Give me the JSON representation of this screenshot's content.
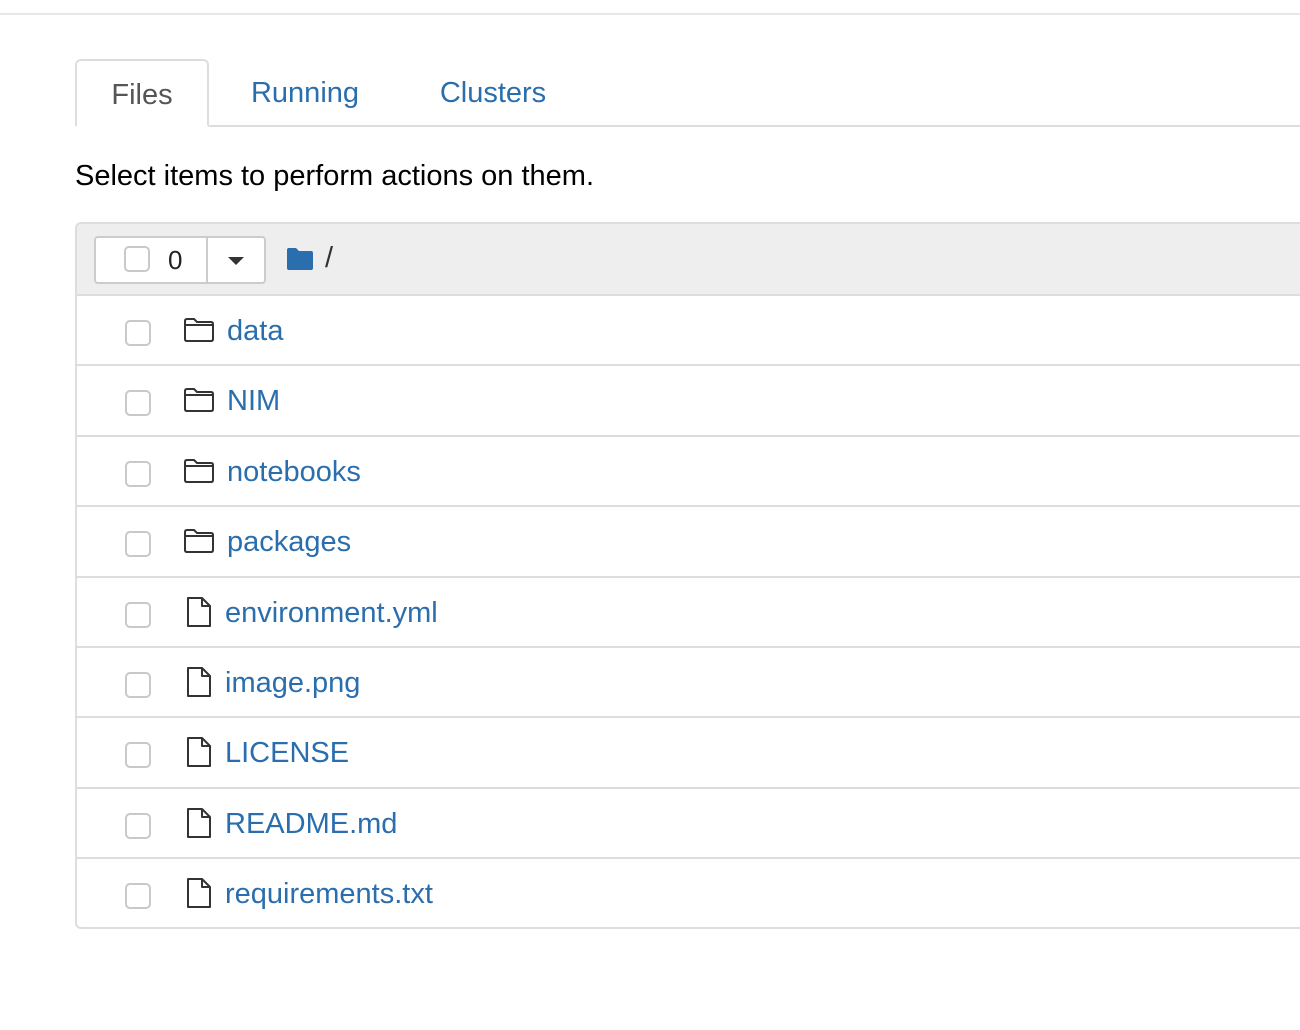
{
  "tabs": [
    {
      "label": "Files",
      "active": true
    },
    {
      "label": "Running",
      "active": false
    },
    {
      "label": "Clusters",
      "active": false
    }
  ],
  "instructions": "Select items to perform actions on them.",
  "toolbar": {
    "selected_count": "0",
    "breadcrumb_separator": "/"
  },
  "items": [
    {
      "name": "data",
      "type": "folder"
    },
    {
      "name": "NIM",
      "type": "folder"
    },
    {
      "name": "notebooks",
      "type": "folder"
    },
    {
      "name": "packages",
      "type": "folder"
    },
    {
      "name": "environment.yml",
      "type": "file"
    },
    {
      "name": "image.png",
      "type": "file"
    },
    {
      "name": "LICENSE",
      "type": "file"
    },
    {
      "name": "README.md",
      "type": "file"
    },
    {
      "name": "requirements.txt",
      "type": "file"
    }
  ],
  "colors": {
    "link": "#2a6ead",
    "header_bg": "#eeeeee",
    "border": "#dddddd"
  }
}
